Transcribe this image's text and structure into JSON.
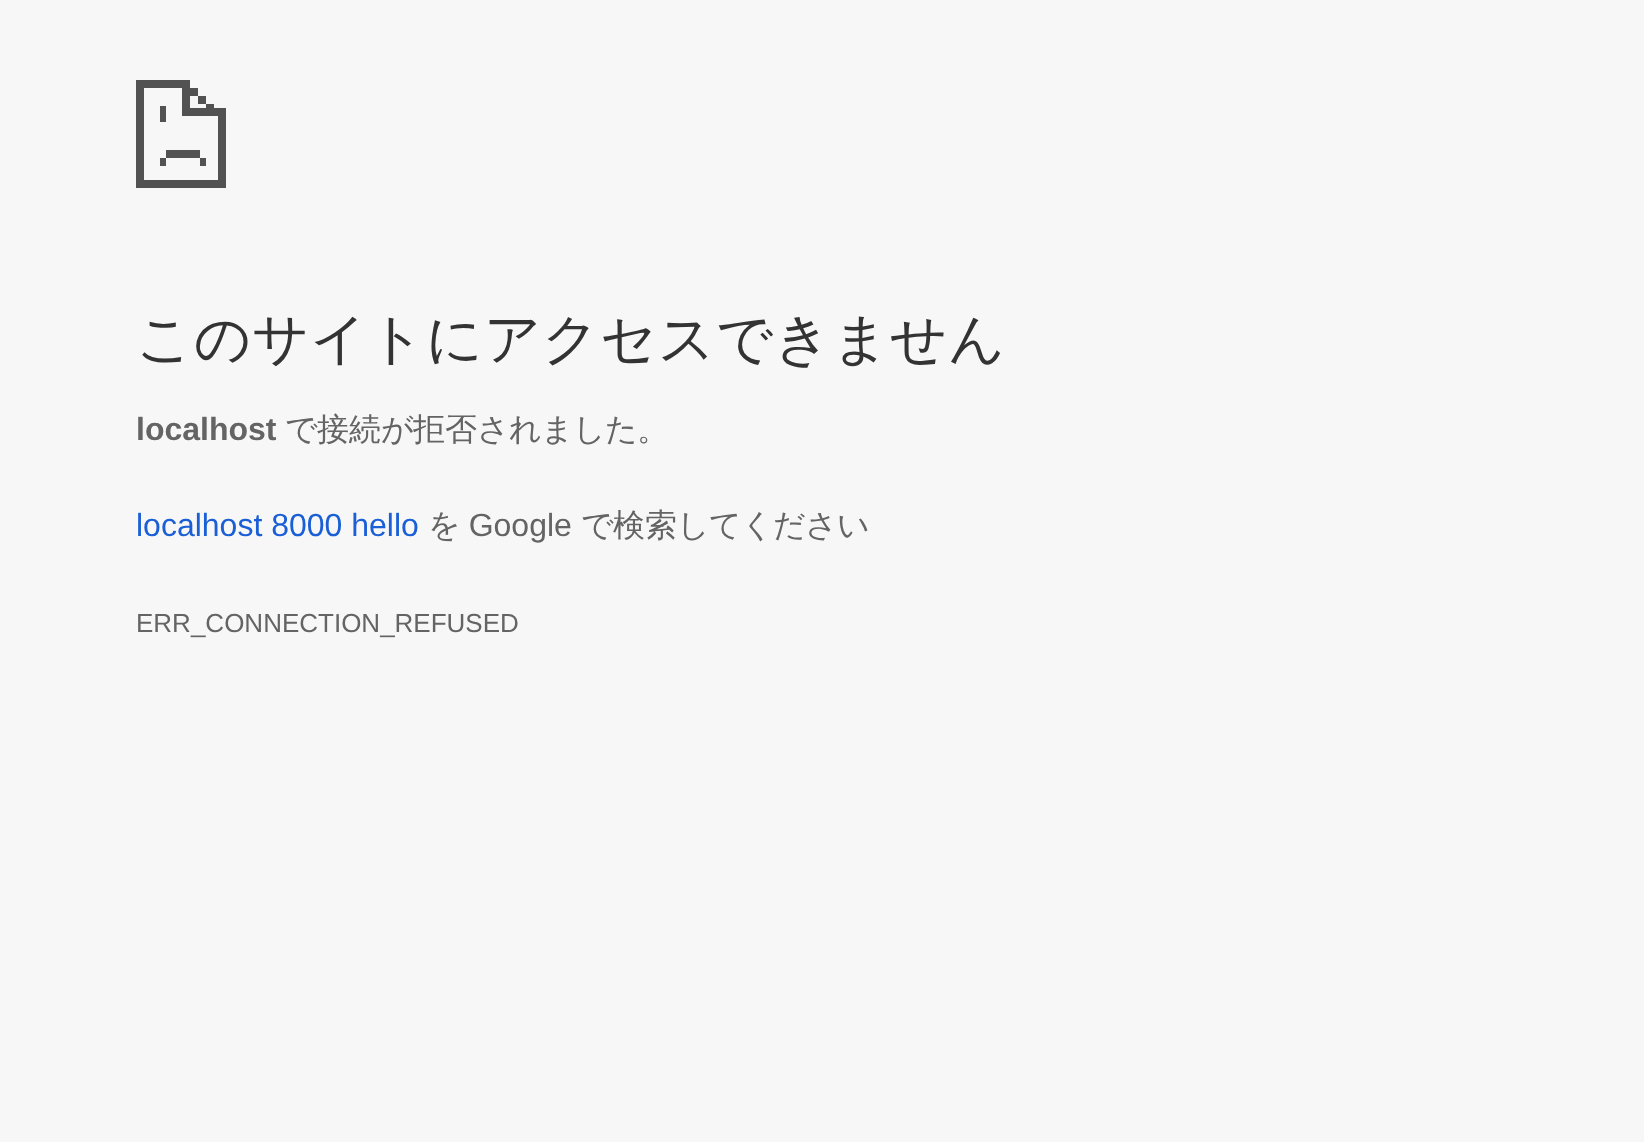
{
  "heading": "このサイトにアクセスできません",
  "message": "**localhost** で接続が拒否されました。",
  "suggestion": {
    "link": "localhost 8000 hello",
    "rest": " を Google で検索してください"
  },
  "error_code": "ERR_CONNECTION_REFUSED"
}
